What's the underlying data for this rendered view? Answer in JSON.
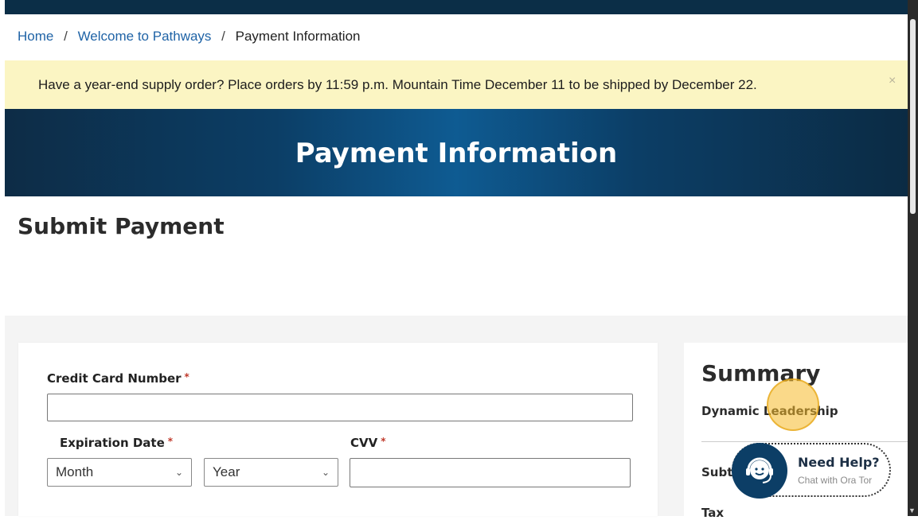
{
  "breadcrumb": {
    "home": "Home",
    "separator": "/",
    "welcome": "Welcome to Pathways",
    "current": "Payment Information"
  },
  "alert": {
    "message": "Have a year-end supply order? Place orders by 11:59 p.m. Mountain Time December 11 to be shipped by December 22.",
    "close": "×"
  },
  "hero": {
    "title": "Payment Information"
  },
  "page": {
    "heading": "Submit Payment"
  },
  "form": {
    "card_number_label": "Credit Card Number",
    "required_marker": "*",
    "card_number_value": "",
    "expiration_label": "Expiration Date",
    "month_value": "Month",
    "year_value": "Year",
    "cvv_label": "CVV",
    "cvv_value": ""
  },
  "summary": {
    "title": "Summary",
    "item": "Dynamic Leadership",
    "subtotal_label": "Subtotal",
    "tax_label": "Tax"
  },
  "help_widget": {
    "title": "Need Help?",
    "subtitle": "Chat with Ora Tor"
  },
  "icons": [
    "chevron-down-icon",
    "chat-agent-icon",
    "close-icon"
  ],
  "colors": {
    "header_navy": "#0b2e47",
    "hero_blue": "#0e5b92",
    "alert_yellow": "#fbf5c3",
    "link_blue": "#1f63a6",
    "required_red": "#c0392b"
  }
}
